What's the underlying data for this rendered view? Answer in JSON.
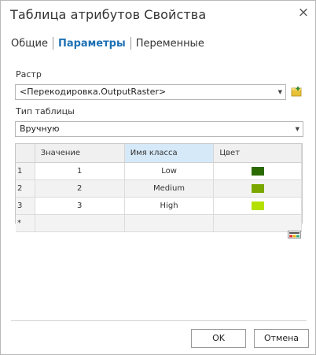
{
  "dialog": {
    "title": "Таблица атрибутов Свойства",
    "close_glyph": "×"
  },
  "tabs": [
    {
      "label": "Общие",
      "active": false
    },
    {
      "label": "Параметры",
      "active": true
    },
    {
      "label": "Переменные",
      "active": false
    }
  ],
  "raster": {
    "label": "Растр",
    "value": "<Перекодировка.OutputRaster>"
  },
  "table_type": {
    "label": "Тип таблицы",
    "value": "Вручную"
  },
  "grid": {
    "columns": [
      "Значение",
      "Имя класса",
      "Цвет"
    ],
    "rows": [
      {
        "num": "1",
        "value": "1",
        "class_name": "Low",
        "color": "#2b6a00"
      },
      {
        "num": "2",
        "value": "2",
        "class_name": "Medium",
        "color": "#7aa800"
      },
      {
        "num": "3",
        "value": "3",
        "class_name": "High",
        "color": "#b4e000"
      }
    ],
    "new_row_marker": "*"
  },
  "buttons": {
    "ok": "OK",
    "cancel": "Отмена"
  }
}
